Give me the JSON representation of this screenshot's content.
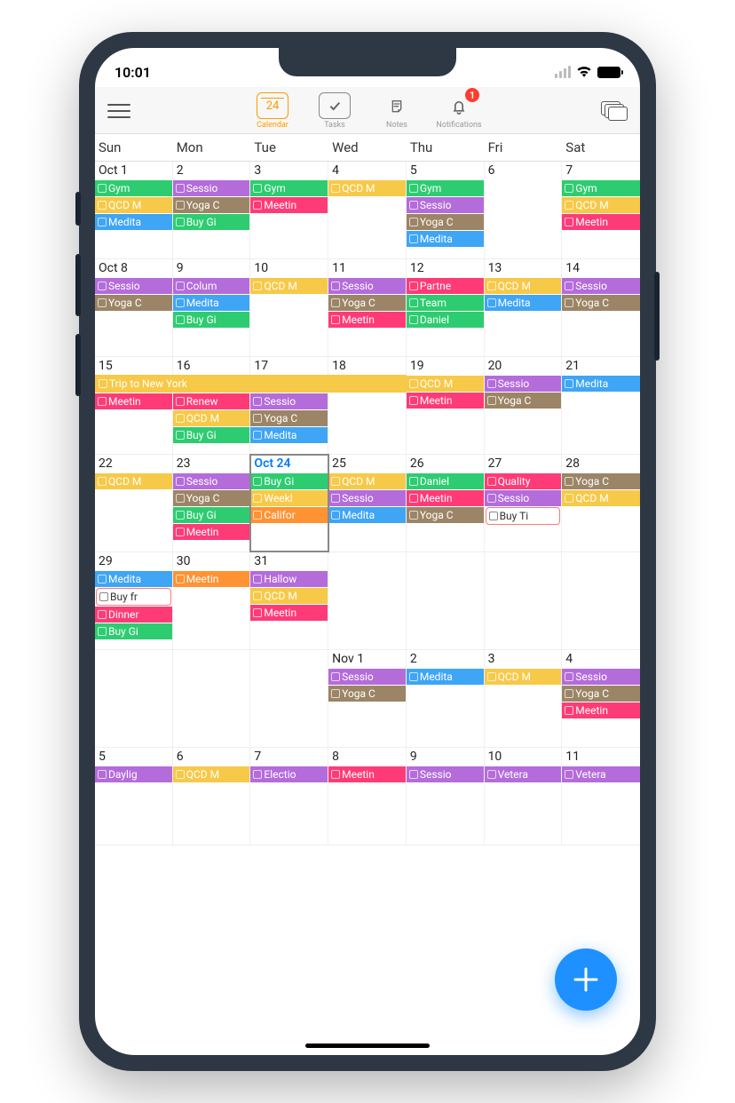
{
  "status": {
    "time": "10:01"
  },
  "toolbar": {
    "nav": [
      {
        "label": "Calendar",
        "icon_text": "24",
        "active": true
      },
      {
        "label": "Tasks",
        "icon_text": "✓"
      },
      {
        "label": "Notes",
        "icon_text": ""
      },
      {
        "label": "Notifications",
        "icon_text": "",
        "badge": "1"
      }
    ]
  },
  "dayHeaders": [
    "Sun",
    "Mon",
    "Tue",
    "Wed",
    "Thu",
    "Fri",
    "Sat"
  ],
  "weeks": [
    {
      "days": [
        {
          "date": "Oct 1",
          "events": [
            {
              "t": "Gym",
              "c": "green"
            },
            {
              "t": "QCD M",
              "c": "yellow"
            },
            {
              "t": "Medita",
              "c": "blue"
            }
          ]
        },
        {
          "date": "2",
          "events": [
            {
              "t": "Sessio",
              "c": "purple"
            },
            {
              "t": "Yoga C",
              "c": "brown"
            },
            {
              "t": "Buy Gi",
              "c": "green"
            }
          ]
        },
        {
          "date": "3",
          "events": [
            {
              "t": "Gym",
              "c": "green"
            },
            {
              "t": "Meetin",
              "c": "pink"
            }
          ]
        },
        {
          "date": "4",
          "events": [
            {
              "t": "QCD M",
              "c": "yellow"
            }
          ]
        },
        {
          "date": "5",
          "events": [
            {
              "t": "Gym",
              "c": "green"
            },
            {
              "t": "Sessio",
              "c": "purple"
            },
            {
              "t": "Yoga C",
              "c": "brown"
            },
            {
              "t": "Medita",
              "c": "blue"
            }
          ]
        },
        {
          "date": "6",
          "events": []
        },
        {
          "date": "7",
          "events": [
            {
              "t": "Gym",
              "c": "green"
            },
            {
              "t": "QCD M",
              "c": "yellow"
            },
            {
              "t": "Meetin",
              "c": "pink"
            }
          ]
        }
      ]
    },
    {
      "days": [
        {
          "date": "Oct 8",
          "events": [
            {
              "t": "Sessio",
              "c": "purple"
            },
            {
              "t": "Yoga C",
              "c": "brown"
            }
          ]
        },
        {
          "date": "9",
          "events": [
            {
              "t": "Colum",
              "c": "purple"
            },
            {
              "t": "Medita",
              "c": "blue"
            },
            {
              "t": "Buy Gi",
              "c": "green"
            }
          ]
        },
        {
          "date": "10",
          "events": [
            {
              "t": "QCD M",
              "c": "yellow"
            }
          ]
        },
        {
          "date": "11",
          "events": [
            {
              "t": "Sessio",
              "c": "purple"
            },
            {
              "t": "Yoga C",
              "c": "brown"
            },
            {
              "t": "Meetin",
              "c": "pink"
            }
          ]
        },
        {
          "date": "12",
          "events": [
            {
              "t": "Partne",
              "c": "pink"
            },
            {
              "t": "Team ",
              "c": "green"
            },
            {
              "t": "Daniel",
              "c": "green"
            }
          ]
        },
        {
          "date": "13",
          "events": [
            {
              "t": "QCD M",
              "c": "yellow"
            },
            {
              "t": "Medita",
              "c": "blue"
            }
          ]
        },
        {
          "date": "14",
          "events": [
            {
              "t": "Sessio",
              "c": "purple"
            },
            {
              "t": "Yoga C",
              "c": "brown"
            }
          ]
        }
      ]
    },
    {
      "span": {
        "text": "Trip to New York",
        "c": "yellow",
        "startCol": 0,
        "endCol": 4
      },
      "days": [
        {
          "date": "15",
          "pushTop": true,
          "events": [
            {
              "t": "Meetin",
              "c": "pink"
            }
          ]
        },
        {
          "date": "16",
          "pushTop": true,
          "events": [
            {
              "t": "Renew",
              "c": "pink"
            },
            {
              "t": "QCD M",
              "c": "yellow"
            },
            {
              "t": "Buy Gi",
              "c": "green"
            }
          ]
        },
        {
          "date": "17",
          "pushTop": true,
          "events": [
            {
              "t": "Sessio",
              "c": "purple"
            },
            {
              "t": "Yoga C",
              "c": "brown"
            },
            {
              "t": "Medita",
              "c": "blue"
            }
          ]
        },
        {
          "date": "18",
          "pushTop": true,
          "events": []
        },
        {
          "date": "19",
          "events": [
            {
              "t": "QCD M",
              "c": "yellow"
            },
            {
              "t": "Meetin",
              "c": "pink"
            }
          ]
        },
        {
          "date": "20",
          "events": [
            {
              "t": "Sessio",
              "c": "purple"
            },
            {
              "t": "Yoga C",
              "c": "brown"
            }
          ]
        },
        {
          "date": "21",
          "events": [
            {
              "t": "Medita",
              "c": "blue"
            }
          ]
        }
      ]
    },
    {
      "days": [
        {
          "date": "22",
          "events": [
            {
              "t": "QCD M",
              "c": "yellow"
            }
          ]
        },
        {
          "date": "23",
          "events": [
            {
              "t": "Sessio",
              "c": "purple"
            },
            {
              "t": "Yoga C",
              "c": "brown"
            },
            {
              "t": "Buy Gi",
              "c": "green"
            },
            {
              "t": "Meetin",
              "c": "pink"
            }
          ]
        },
        {
          "date": "Oct 24",
          "today": true,
          "events": [
            {
              "t": "Buy Gi",
              "c": "green"
            },
            {
              "t": "Weekl",
              "c": "yellow"
            },
            {
              "t": "Califor",
              "c": "orange"
            }
          ]
        },
        {
          "date": "25",
          "events": [
            {
              "t": "QCD M",
              "c": "yellow"
            },
            {
              "t": "Sessio",
              "c": "purple"
            },
            {
              "t": "Medita",
              "c": "blue"
            }
          ]
        },
        {
          "date": "26",
          "events": [
            {
              "t": "Daniel",
              "c": "green"
            },
            {
              "t": "Meetin",
              "c": "pink"
            },
            {
              "t": "Yoga C",
              "c": "brown"
            }
          ]
        },
        {
          "date": "27",
          "events": [
            {
              "t": "Quality",
              "c": "pink"
            },
            {
              "t": "Sessio",
              "c": "purple"
            },
            {
              "t": "Buy Ti",
              "c": "task"
            }
          ]
        },
        {
          "date": "28",
          "events": [
            {
              "t": "Yoga C",
              "c": "brown"
            },
            {
              "t": "QCD M",
              "c": "yellow"
            }
          ]
        }
      ]
    },
    {
      "days": [
        {
          "date": "29",
          "events": [
            {
              "t": "Medita",
              "c": "blue"
            },
            {
              "t": "Buy fr",
              "c": "task"
            },
            {
              "t": "Dinner",
              "c": "pink"
            },
            {
              "t": "Buy Gi",
              "c": "green"
            }
          ]
        },
        {
          "date": "30",
          "events": [
            {
              "t": "Meetin",
              "c": "orange"
            }
          ]
        },
        {
          "date": "31",
          "events": [
            {
              "t": "Hallow",
              "c": "purple"
            },
            {
              "t": "QCD M",
              "c": "yellow"
            },
            {
              "t": "Meetin",
              "c": "pink"
            }
          ]
        },
        {
          "date": "",
          "events": []
        },
        {
          "date": "",
          "events": []
        },
        {
          "date": "",
          "events": []
        },
        {
          "date": "",
          "events": []
        }
      ]
    },
    {
      "days": [
        {
          "date": "",
          "events": []
        },
        {
          "date": "",
          "events": []
        },
        {
          "date": "",
          "events": []
        },
        {
          "date": "Nov 1",
          "events": [
            {
              "t": "Sessio",
              "c": "purple"
            },
            {
              "t": "Yoga C",
              "c": "brown"
            }
          ]
        },
        {
          "date": "2",
          "events": [
            {
              "t": "Medita",
              "c": "blue"
            }
          ]
        },
        {
          "date": "3",
          "events": [
            {
              "t": "QCD M",
              "c": "yellow"
            }
          ]
        },
        {
          "date": "4",
          "events": [
            {
              "t": "Sessio",
              "c": "purple"
            },
            {
              "t": "Yoga C",
              "c": "brown"
            },
            {
              "t": "Meetin",
              "c": "pink"
            }
          ]
        }
      ]
    },
    {
      "days": [
        {
          "date": "5",
          "events": [
            {
              "t": "Daylig",
              "c": "purple"
            }
          ]
        },
        {
          "date": "6",
          "events": [
            {
              "t": "QCD M",
              "c": "yellow"
            }
          ]
        },
        {
          "date": "7",
          "events": [
            {
              "t": "Electio",
              "c": "purple"
            }
          ]
        },
        {
          "date": "8",
          "events": [
            {
              "t": "Meetin",
              "c": "pink"
            }
          ]
        },
        {
          "date": "9",
          "events": [
            {
              "t": "Sessio",
              "c": "purple"
            }
          ]
        },
        {
          "date": "10",
          "events": [
            {
              "t": "Vetera",
              "c": "purple"
            }
          ]
        },
        {
          "date": "11",
          "events": [
            {
              "t": "Vetera",
              "c": "purple"
            }
          ]
        }
      ]
    }
  ]
}
